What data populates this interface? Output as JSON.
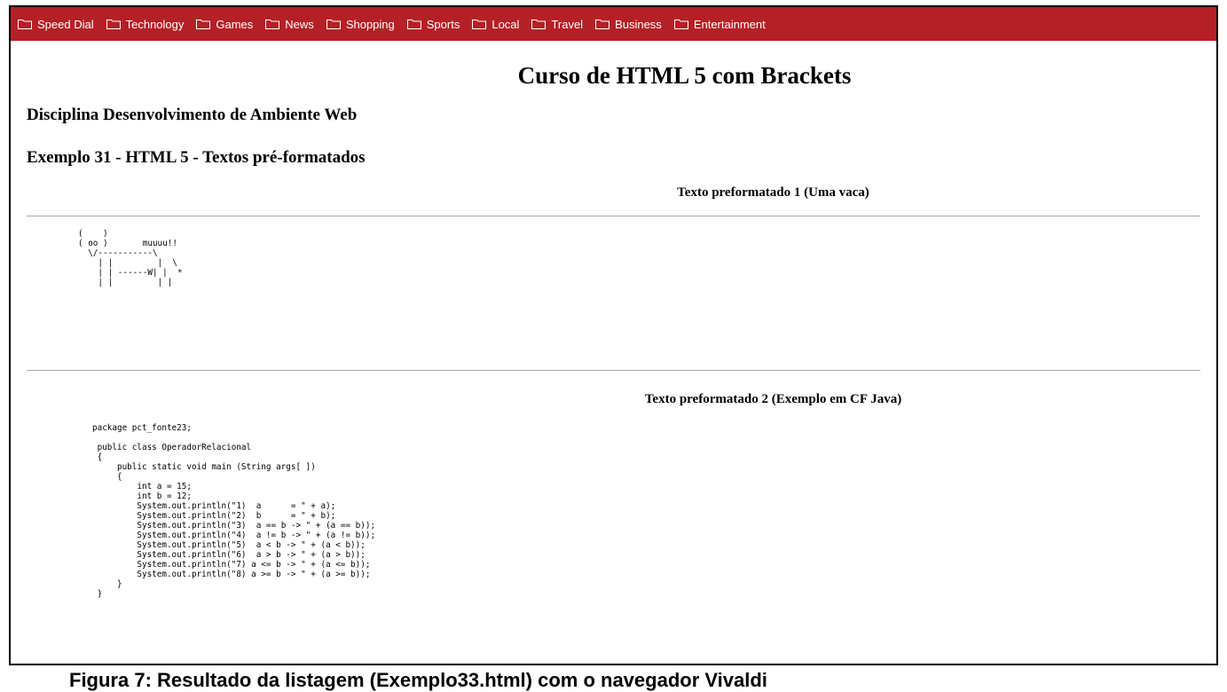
{
  "bookmarks": [
    {
      "label": "Speed Dial"
    },
    {
      "label": "Technology"
    },
    {
      "label": "Games"
    },
    {
      "label": "News"
    },
    {
      "label": "Shopping"
    },
    {
      "label": "Sports"
    },
    {
      "label": "Local"
    },
    {
      "label": "Travel"
    },
    {
      "label": "Business"
    },
    {
      "label": "Entertainment"
    }
  ],
  "colors": {
    "bookmark_bar": "#b52026"
  },
  "page": {
    "title": "Curso de HTML 5 com Brackets",
    "subtitle": "Disciplina Desenvolvimento de Ambiente Web",
    "example_heading": "Exemplo 31 - HTML 5 - Textos pré-formatados",
    "section1_heading": "Texto preformatado 1 (Uma vaca)",
    "cow_text": "(    )\n( oo )       muuuu!!\n  \\/-----------\\\n    | |         |  \\\n    | | ------W| |  *\n    | |         | |",
    "section2_heading": "Texto preformatado 2 (Exemplo em CF Java)",
    "java_code": "package pct_fonte23;\n\n public class OperadorRelacional\n {\n     public static void main (String args[ ])\n     {\n         int a = 15;\n         int b = 12;\n         System.out.println(\"1)  a      = \" + a);\n         System.out.println(\"2)  b      = \" + b);\n         System.out.println(\"3)  a == b -> \" + (a == b));\n         System.out.println(\"4)  a != b -> \" + (a != b));\n         System.out.println(\"5)  a < b -> \" + (a < b));\n         System.out.println(\"6)  a > b -> \" + (a > b));\n         System.out.println(\"7) a <= b -> \" + (a <= b));\n         System.out.println(\"8) a >= b -> \" + (a >= b));\n     }\n }"
  },
  "caption": "Figura 7: Resultado da listagem (Exemplo33.html)  com o navegador Vivaldi"
}
